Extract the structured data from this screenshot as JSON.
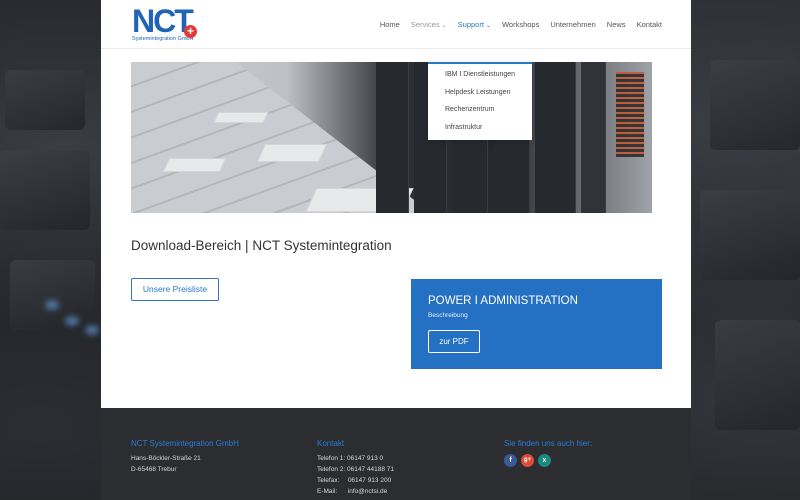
{
  "logo": {
    "text": "NCT",
    "plus": "+",
    "sub": "Systemintegration GmbH"
  },
  "nav": {
    "items": [
      {
        "label": "Home"
      },
      {
        "label": "Services",
        "chevron": "⌄"
      },
      {
        "label": "Support",
        "chevron": "⌄"
      },
      {
        "label": "Workshops"
      },
      {
        "label": "Unternehmen"
      },
      {
        "label": "News"
      },
      {
        "label": "Kontakt"
      }
    ]
  },
  "dropdown": {
    "items": [
      "IBM I Dienstleistungen",
      "Helpdesk Leistungen",
      "Rechenzentrum",
      "Infrastruktur"
    ]
  },
  "page": {
    "title": "Download-Bereich | NCT Systemintegration",
    "price_button": "Unsere Preisliste"
  },
  "card": {
    "title": "POWER I ADMINISTRATION",
    "description": "Beschreibung",
    "button": "zur PDF"
  },
  "footer": {
    "company": {
      "heading": "NCT Systemintegration GmbH",
      "street": "Hans-Böckler-Straße 21",
      "city": "D-65468 Trebur"
    },
    "contact": {
      "heading": "Kontakt",
      "phone1": "Telefon 1: 06147 913 0",
      "phone2": "Telefon 2: 06147 44188 71",
      "fax_label": "Telefax:",
      "fax": "06147 913 200",
      "email_label": "E-Mail:",
      "email": "info@nctsi.de"
    },
    "social": {
      "heading": "Sie finden uns auch hier:",
      "icons": [
        {
          "name": "facebook-icon",
          "glyph": "f",
          "color": "#3b5998"
        },
        {
          "name": "google-plus-icon",
          "glyph": "g+",
          "color": "#dd4b39"
        },
        {
          "name": "xing-icon",
          "glyph": "x",
          "color": "#1a8a7d"
        }
      ]
    }
  },
  "colors": {
    "accent": "#2470c2",
    "footer_bg": "#2b2d31"
  }
}
